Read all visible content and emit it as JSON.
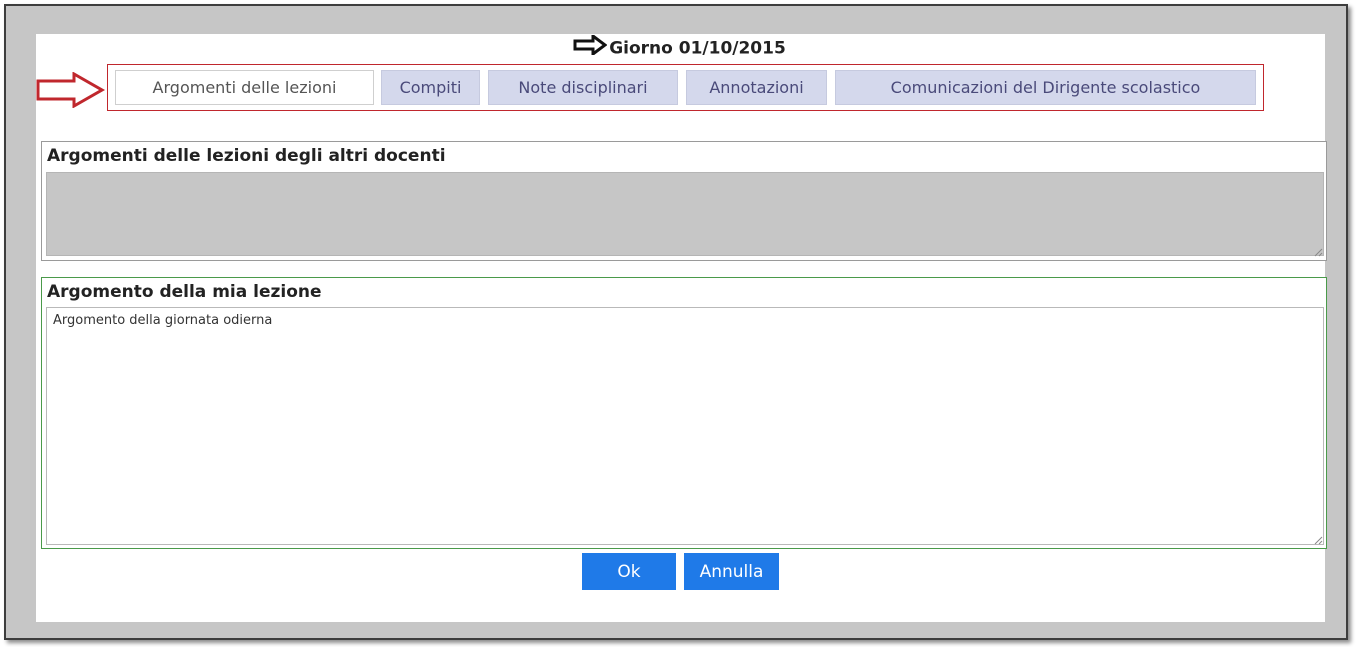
{
  "header": {
    "title": "Giorno 01/10/2015"
  },
  "tabs": [
    {
      "label": "Argomenti delle lezioni",
      "active": true
    },
    {
      "label": "Compiti",
      "active": false
    },
    {
      "label": "Note disciplinari",
      "active": false
    },
    {
      "label": "Annotazioni",
      "active": false
    },
    {
      "label": "Comunicazioni del Dirigente scolastico",
      "active": false
    }
  ],
  "others_lessons": {
    "label": "Argomenti delle lezioni degli altri docenti",
    "value": ""
  },
  "my_lesson": {
    "label": "Argomento della mia lezione",
    "value": "Argomento della giornata odierna"
  },
  "buttons": {
    "ok": "Ok",
    "cancel": "Annulla"
  },
  "colors": {
    "accent": "#1f7ae8",
    "highlight": "#c0272d",
    "tab_bg": "#d4d8ec"
  }
}
